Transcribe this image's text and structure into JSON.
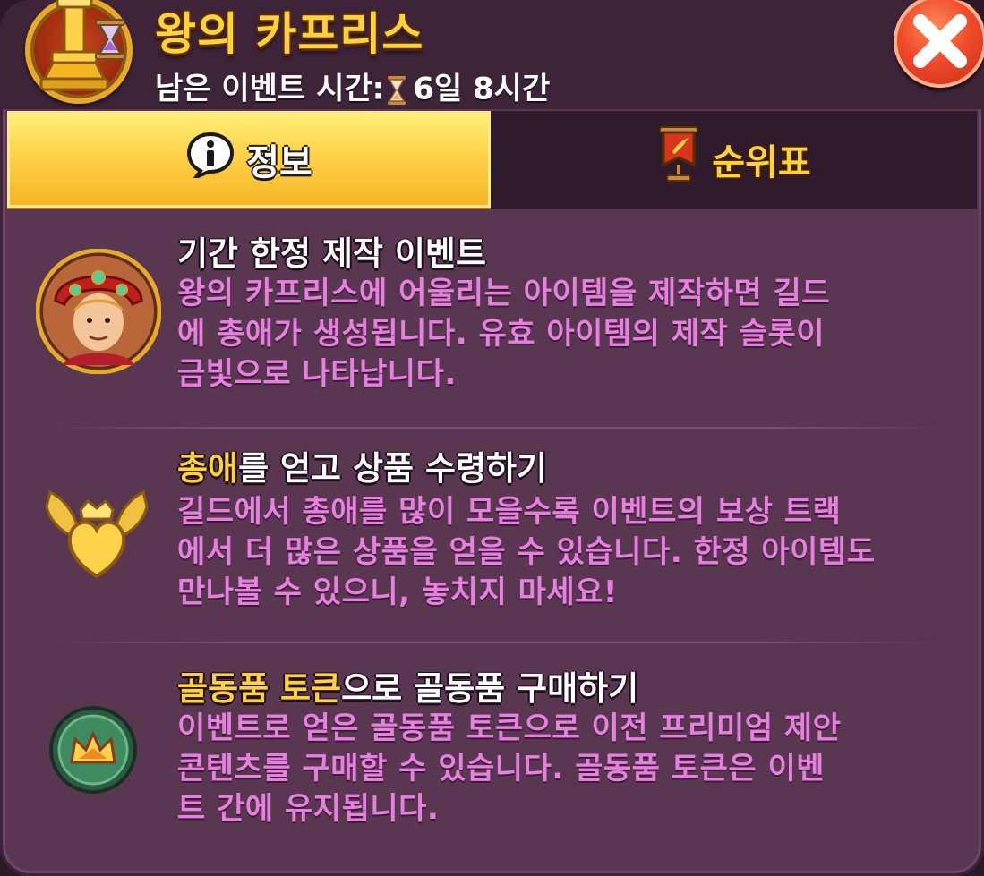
{
  "header": {
    "title": "왕의 카프리스",
    "timer_label": "남은 이벤트 시간:",
    "timer_value": "6일 8시간",
    "emblem_icon": "trophy-hourglass-icon",
    "close_icon": "close-x-icon"
  },
  "tabs": [
    {
      "label": "정보",
      "icon": "info-bubble-icon",
      "active": true
    },
    {
      "label": "순위표",
      "icon": "banner-quill-icon",
      "active": false
    }
  ],
  "sections": [
    {
      "icon": "king-portrait-avatar",
      "heading_hl": "",
      "heading_rest": "기간 한정 제작 이벤트",
      "body_lines": [
        "왕의 카프리스에 어울리는 아이템을 제작하면 길드",
        "에 총애가 생성됩니다. 유효 아이템의 제작 슬롯이",
        "금빛으로 나타납니다."
      ]
    },
    {
      "icon": "winged-heart-crown-icon",
      "heading_hl": "총애",
      "heading_rest": "를 얻고 상품 수령하기",
      "body_lines": [
        "길드에서 총애를 많이 모을수록 이벤트의 보상 트랙",
        "에서 더 많은 상품을 얻을 수 있습니다. 한정 아이템도",
        "만나볼 수 있으니, 놓치지 마세요!"
      ]
    },
    {
      "icon": "crown-token-icon",
      "heading_hl": "골동품 토큰",
      "heading_rest": "으로 골동품 구매하기",
      "body_lines": [
        "이벤트로 얻은 골동품 토큰으로 이전 프리미엄 제안",
        "콘텐츠를 구매할 수 있습니다. 골동품 토큰은 이벤",
        "트 간에 유지됩니다."
      ]
    }
  ],
  "colors": {
    "panel": "#5a3751",
    "header": "#3e2439",
    "title_gold": "#ffd23c",
    "body_pink": "#e77fe0",
    "active_tab": "#ffd24a",
    "close_red": "#f0492a"
  }
}
